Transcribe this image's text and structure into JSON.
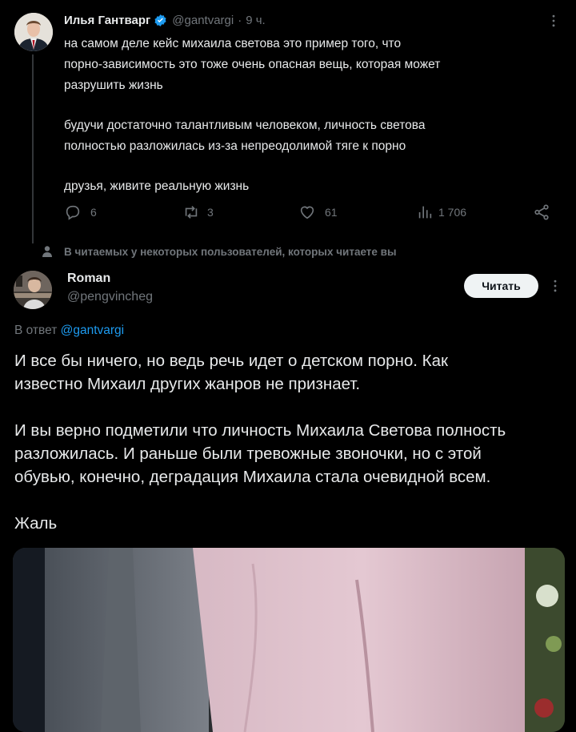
{
  "tweet1": {
    "author_name": "Илья Гантварг",
    "handle": "@gantvargi",
    "separator": "·",
    "time": "9 ч.",
    "paragraphs": [
      [
        "на самом деле кейс михаила светова это пример того, что",
        "порно-зависимость это тоже очень опасная вещь, которая может",
        "разрушить жизнь"
      ],
      [
        "будучи достаточно талантливым человеком, личность светова",
        "полностью разложилась из-за непреодолимой тяге к порно"
      ],
      [
        "друзья, живите реальную жизнь"
      ]
    ],
    "stats": {
      "replies": "6",
      "retweets": "3",
      "likes": "61",
      "views": "1 706"
    }
  },
  "context_label": "В читаемых у некоторых пользователей, которых читаете вы",
  "tweet2": {
    "author_name": "Roman",
    "handle": "@pengvincheg",
    "follow_label": "Читать",
    "reply_prefix": "В ответ",
    "reply_handle": "@gantvargi",
    "paragraphs": [
      [
        "И все бы ничего, но ведь речь идет о детском порно. Как",
        "известно Михаил других жанров не признает."
      ],
      [
        "И вы верно подметили что личность Михаила Светова полность",
        "разложилась. И раньше были тревожные звоночки, но с этой",
        "обувью, конечно, деградация Михаила стала очевидной всем."
      ],
      [
        "Жаль"
      ]
    ]
  },
  "colors": {
    "accent": "#1d9bf0",
    "text": "#e7e9ea",
    "muted": "#71767b",
    "bg": "#000000"
  },
  "icons": [
    "verified-badge-icon",
    "more-icon",
    "reply-icon",
    "retweet-icon",
    "like-icon",
    "views-icon",
    "share-icon",
    "person-icon"
  ]
}
